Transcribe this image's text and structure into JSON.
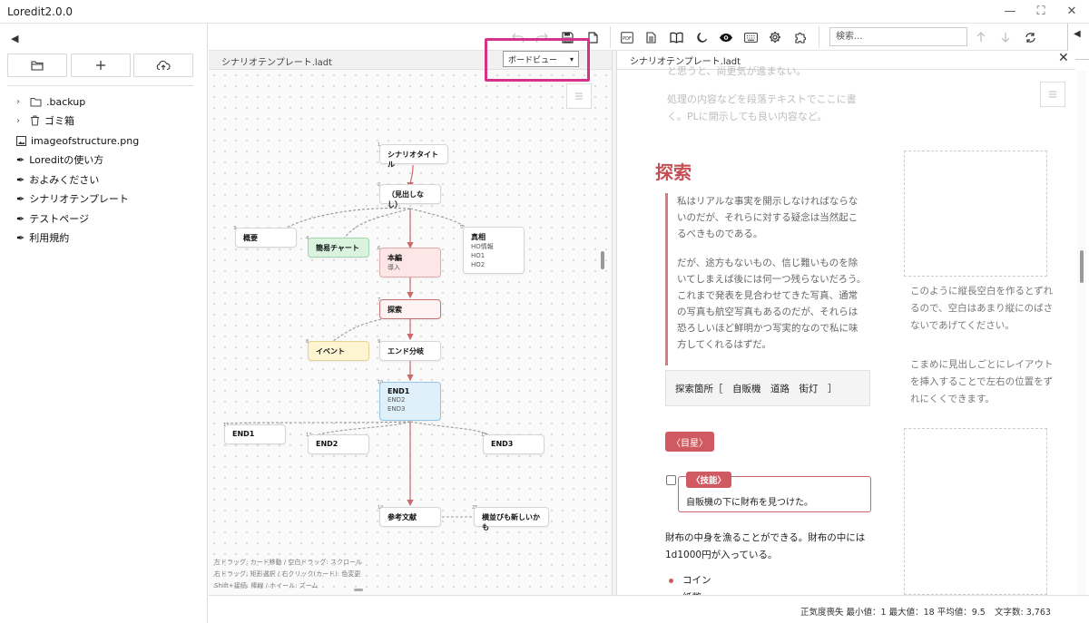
{
  "app": {
    "title": "Loredit2.0.0"
  },
  "sidebar": {
    "collapse_glyph": "◀",
    "buttons": [
      "open-folder-icon",
      "plus-icon",
      "cloud-upload-icon"
    ],
    "items": [
      {
        "label": ".backup",
        "icon": "folder-icon",
        "expandable": true
      },
      {
        "label": "ゴミ箱",
        "icon": "trash-icon",
        "expandable": true
      },
      {
        "label": "imageofstructure.png",
        "icon": "image-file-icon",
        "expandable": false
      },
      {
        "label": "Loreditの使い方",
        "icon": "quill-icon",
        "expandable": false
      },
      {
        "label": "およみください",
        "icon": "quill-icon",
        "expandable": false
      },
      {
        "label": "シナリオテンプレート",
        "icon": "quill-icon",
        "expandable": false
      },
      {
        "label": "テストページ",
        "icon": "quill-icon",
        "expandable": false
      },
      {
        "label": "利用規約",
        "icon": "quill-icon",
        "expandable": false
      }
    ]
  },
  "toolbar": {
    "search_placeholder": "検索...",
    "right_collapse_glyph": "◀"
  },
  "left_pane": {
    "filename": "シナリオテンプレート.ladt",
    "view_select": "ボードビュー",
    "cards": [
      {
        "num": "1",
        "title": "シナリオタイトル",
        "sub": []
      },
      {
        "num": "2",
        "title": "（見出しなし）",
        "sub": []
      },
      {
        "num": "3",
        "title": "概要",
        "sub": []
      },
      {
        "num": "4",
        "title": "簡易チャート",
        "sub": []
      },
      {
        "num": "6",
        "title": "本編",
        "sub": [
          "導入"
        ]
      },
      {
        "num": "5",
        "title": "真相",
        "sub": [
          "HO情報",
          "HO1",
          "HO2"
        ]
      },
      {
        "num": "7",
        "title": "探索",
        "sub": []
      },
      {
        "num": "8",
        "title": "イベント",
        "sub": []
      },
      {
        "num": "9",
        "title": "エンド分岐",
        "sub": []
      },
      {
        "num": "10",
        "title": "END1",
        "sub": [
          "END2",
          "END3"
        ]
      },
      {
        "num": "11",
        "title": "END1",
        "sub": []
      },
      {
        "num": "12",
        "title": "END2",
        "sub": []
      },
      {
        "num": "13",
        "title": "END3",
        "sub": []
      },
      {
        "num": "14",
        "title": "参考文献",
        "sub": []
      },
      {
        "num": "25",
        "title": "横並びも新しいかも",
        "sub": []
      }
    ],
    "hints": [
      "左ドラッグ: カード移動 / 空白ドラッグ: スクロール",
      "右ドラッグ: 矩形選択 / 右クリック(カード): 色変更",
      "Shift+接続: 棒線 / ホイール: ズーム"
    ]
  },
  "right_pane": {
    "filename": "シナリオテンプレート.ladt",
    "faded_top": "と思うと、尚更気が進まない。",
    "faded_para": "処理の内容などを段落テキストでここに書く。PLに開示しても良い内容など。",
    "heading": "探索",
    "quote_paragraphs": [
      "私はリアルな事実を開示しなければならないのだが、それらに対する疑念は当然起こるべきものである。",
      "だが、途方もないもの、信じ難いものを除いてしまえば後には何一つ残らないだろう。これまで発表を見合わせてきた写真、通常の写真も航空写真もあるのだが、それらは恐ろしいほど鮮明かつ写実的なので私に味方してくれるはずだ。"
    ],
    "explore_box": "探索箇所［　自販機　道路　街灯　］",
    "badge_mokusei": "〈目星〉",
    "skill_tag": "〈技能〉",
    "skill_text": "自販機の下に財布を見つけた。",
    "para2": "財布の中身を漁ることができる。財布の中には1d1000円が入っている。",
    "bullets": [
      "コイン",
      "紙幣"
    ],
    "side_note1": "このように縦長空白を作るとずれるので、空白はあまり縦にのばさないであげてください。",
    "side_note2": "こまめに見出しごとにレイアウトを挿入することで左右の位置をずれにくくできます。"
  },
  "status": {
    "stats": "正気度喪失 最小値：1 最大値：18 平均値：9.5",
    "char_count": "文字数: 3,763"
  }
}
